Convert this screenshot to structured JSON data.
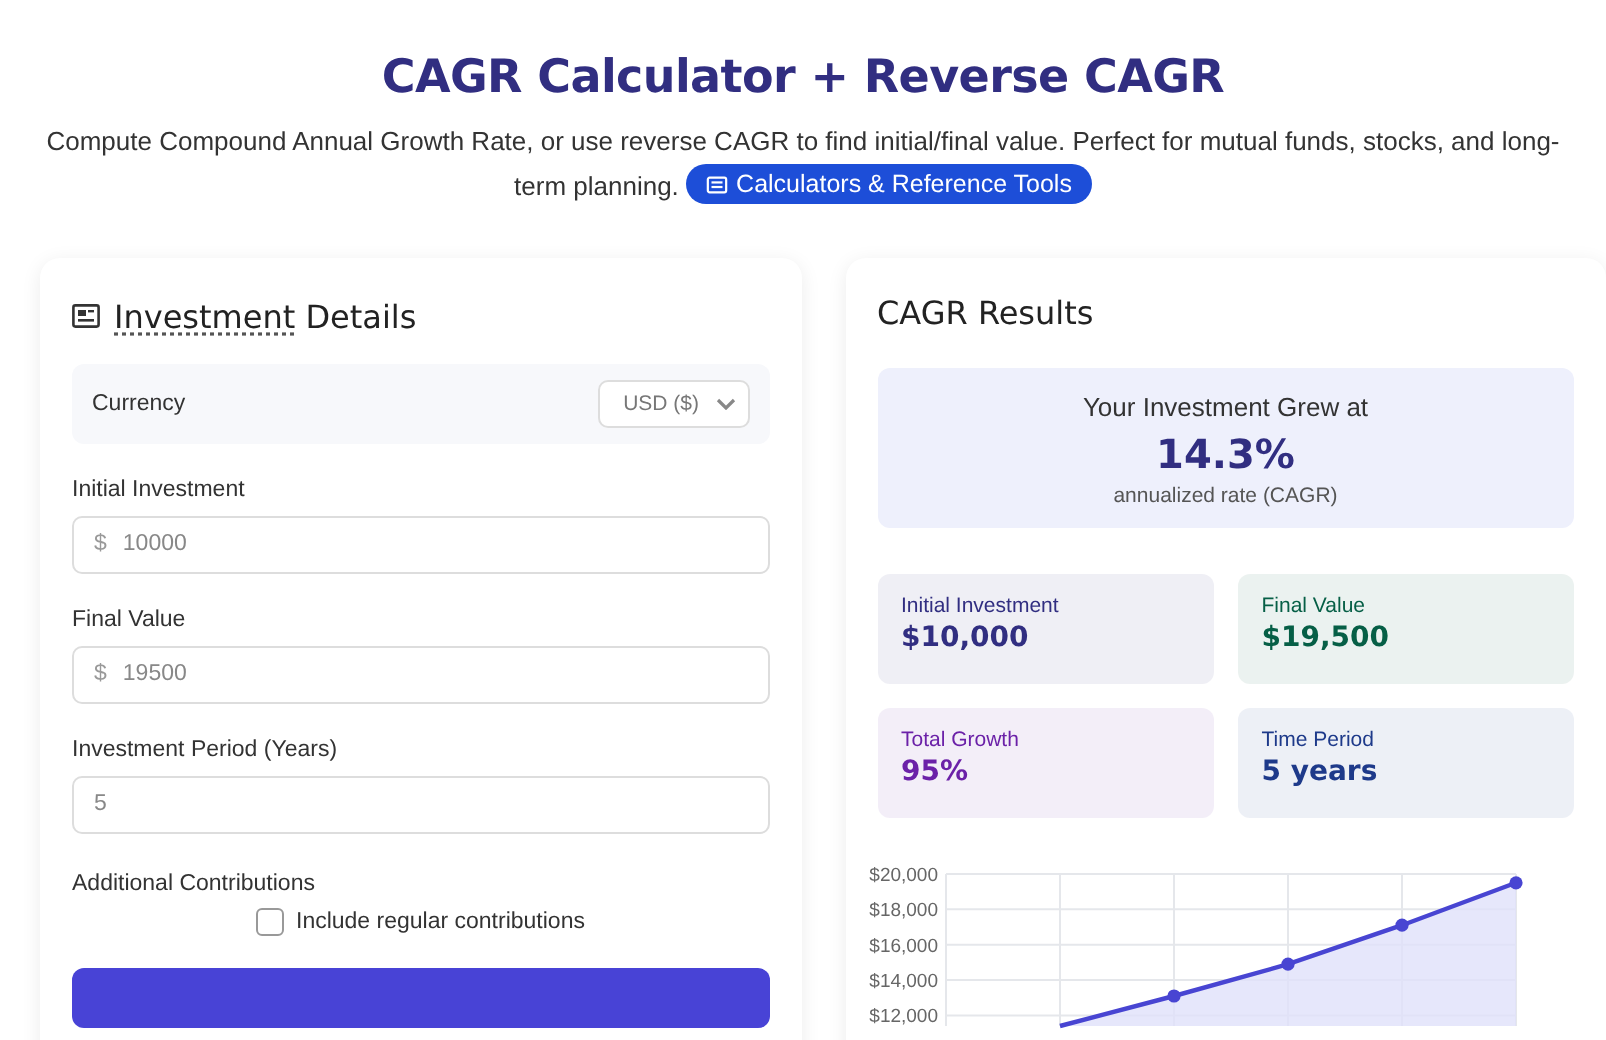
{
  "header": {
    "title": "CAGR Calculator + Reverse CAGR",
    "subtitle": "Compute Compound Annual Growth Rate, or use reverse CAGR to find initial/final value. Perfect for mutual funds, stocks, and long-term planning.",
    "badge": "Calculators & Reference Tools"
  },
  "details": {
    "heading_term": "Investment",
    "heading_rest": "Details",
    "currency": {
      "label": "Currency",
      "value": "USD ($)"
    },
    "fields": [
      {
        "label": "Initial Investment",
        "prefix": "$",
        "placeholder": "10000"
      },
      {
        "label": "Final Value",
        "prefix": "$",
        "placeholder": "19500"
      },
      {
        "label": "Investment Period (Years)",
        "placeholder": "5"
      }
    ],
    "contributions": {
      "label": "Additional Contributions",
      "checkbox_label": "Include regular contributions",
      "checked": false
    }
  },
  "results": {
    "heading": "CAGR Results",
    "highlight": {
      "caption": "Your Investment Grew at",
      "value": "14.3%",
      "note": "annualized rate (CAGR)"
    },
    "stats": [
      {
        "label": "Initial Investment",
        "value": "$10,000",
        "color": "#312e81"
      },
      {
        "label": "Final Value",
        "value": "$19,500",
        "color": "#065f46"
      },
      {
        "label": "Total Growth",
        "value": "95%",
        "color": "#6b21a8"
      },
      {
        "label": "Time Period",
        "value": "5 years",
        "color": "#1e3a8a"
      }
    ],
    "chart_data": {
      "type": "area",
      "values": [
        null,
        11400,
        13100,
        14900,
        17100,
        19500
      ],
      "ylim": [
        11400,
        20000
      ],
      "grid": true,
      "yticks": [
        {
          "value": 12000,
          "label": "$12,000"
        },
        {
          "value": 14000,
          "label": "$14,000"
        },
        {
          "value": 16000,
          "label": "$16,000"
        },
        {
          "value": 18000,
          "label": "$18,000"
        },
        {
          "value": 20000,
          "label": "$20,000"
        }
      ]
    }
  }
}
